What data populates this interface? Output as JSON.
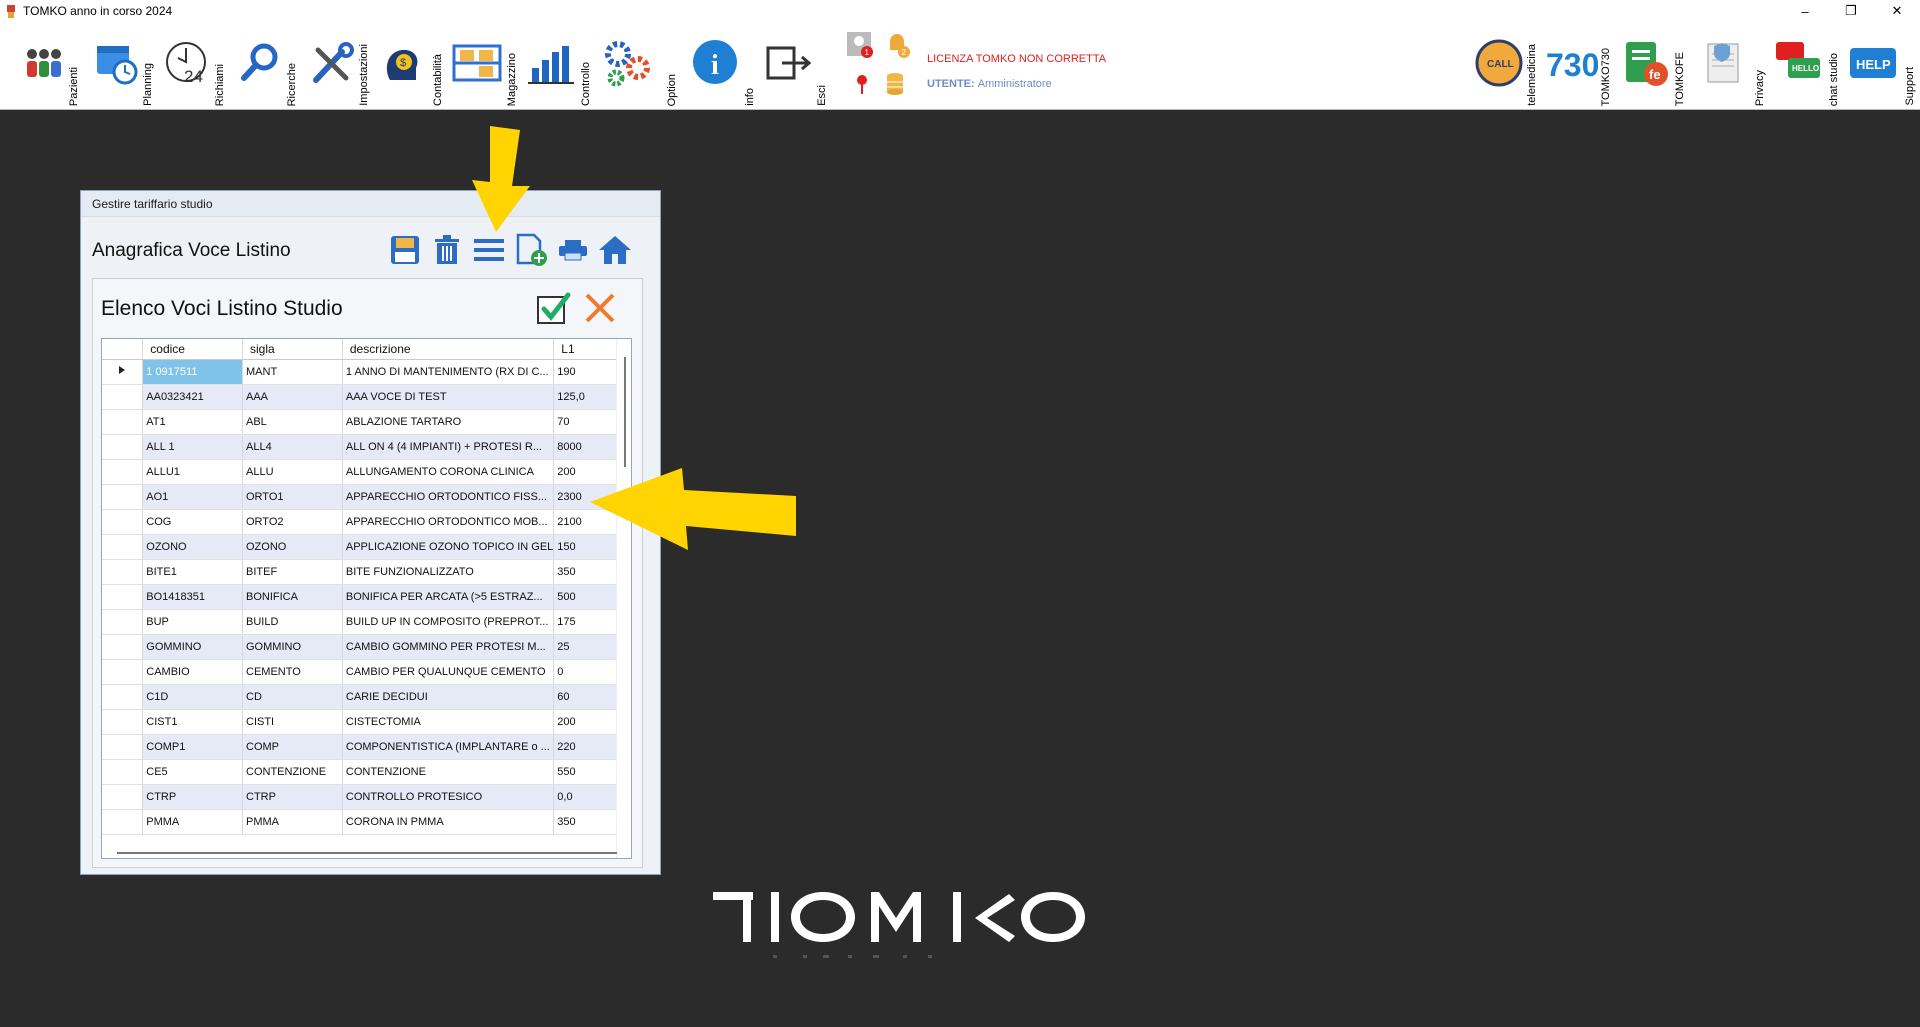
{
  "window": {
    "title": "TOMKO anno in corso 2024",
    "controls": [
      "–",
      "❐",
      "✕"
    ]
  },
  "toolbar": {
    "items": [
      {
        "label": "Pazienti",
        "icon": "patients-icon"
      },
      {
        "label": "Planning",
        "icon": "calendar-icon"
      },
      {
        "label": "Richiami",
        "icon": "clock-24-icon"
      },
      {
        "label": "Ricerche",
        "icon": "search-icon"
      },
      {
        "label": "Impostazioni",
        "icon": "tools-icon"
      },
      {
        "label": "Contabilità",
        "icon": "accounting-icon"
      },
      {
        "label": "Magazzino",
        "icon": "warehouse-icon"
      },
      {
        "label": "Controllo",
        "icon": "chart-icon"
      },
      {
        "label": "Option",
        "icon": "gears-icon"
      },
      {
        "label": "info",
        "icon": "info-icon"
      },
      {
        "label": "Esci",
        "icon": "exit-icon"
      }
    ],
    "license_warning": "LICENZA TOMKO NON CORRETTA",
    "user_label": "UTENTE:",
    "user_name": "Amministratore",
    "notif_badges": [
      "1",
      "2"
    ],
    "right_items": [
      {
        "label": "telemedicina",
        "icon": "call-icon",
        "icon_text": "CALL"
      },
      {
        "label": "TOMKO730",
        "icon": "730-icon",
        "icon_text": "730"
      },
      {
        "label": "TOMKOFE",
        "icon": "fe-icon",
        "icon_text": "fe"
      },
      {
        "label": "Privacy",
        "icon": "privacy-icon"
      },
      {
        "label": "chat studio",
        "icon": "chat-icon",
        "icon_text": "HELLO"
      },
      {
        "label": "Support",
        "icon": "help-icon",
        "icon_text": "HELP"
      }
    ]
  },
  "dialog": {
    "title": "Gestire tariffario studio",
    "header_title": "Anagrafica Voce Listino",
    "inner_title": "Elenco Voci Listino Studio",
    "columns": [
      "codice",
      "sigla",
      "descrizione",
      "L1"
    ],
    "rows": [
      [
        "1 0917511",
        "MANT",
        "1 ANNO DI MANTENIMENTO (RX DI C...",
        "190"
      ],
      [
        "AA0323421",
        "AAA",
        "AAA VOCE DI TEST",
        "125,0"
      ],
      [
        "AT1",
        "ABL",
        "ABLAZIONE TARTARO",
        "70"
      ],
      [
        "ALL 1",
        "ALL4",
        "ALL ON 4 (4 IMPIANTI) + PROTESI R...",
        "8000"
      ],
      [
        "ALLU1",
        "ALLU",
        "ALLUNGAMENTO CORONA CLINICA",
        "200"
      ],
      [
        "AO1",
        "ORTO1",
        "APPARECCHIO ORTODONTICO FISS...",
        "2300"
      ],
      [
        "COG",
        "ORTO2",
        "APPARECCHIO ORTODONTICO MOB...",
        "2100"
      ],
      [
        "OZONO",
        "OZONO",
        "APPLICAZIONE OZONO TOPICO IN GEL",
        "150"
      ],
      [
        "BITE1",
        "BITEF",
        "BITE FUNZIONALIZZATO",
        "350"
      ],
      [
        "BO1418351",
        "BONIFICA",
        "BONIFICA PER ARCATA (>5 ESTRAZ...",
        "500"
      ],
      [
        "BUP",
        "BUILD",
        "BUILD UP IN COMPOSITO (PREPROT...",
        "175"
      ],
      [
        "GOMMINO",
        "GOMMINO",
        "CAMBIO GOMMINO PER PROTESI M...",
        "25"
      ],
      [
        "CAMBIO",
        "CEMENTO",
        "CAMBIO PER QUALUNQUE CEMENTO",
        "0"
      ],
      [
        "C1D",
        "CD",
        "CARIE DECIDUI",
        "60"
      ],
      [
        "CIST1",
        "CISTI",
        "CISTECTOMIA",
        "200"
      ],
      [
        "COMP1",
        "COMP",
        "COMPONENTISTICA (IMPLANTARE o ...",
        "220"
      ],
      [
        "CE5",
        "CONTENZIONE",
        "CONTENZIONE",
        "550"
      ],
      [
        "CTRP",
        "CTRP",
        "CONTROLLO PROTESICO",
        "0,0"
      ],
      [
        "PMMA",
        "PMMA",
        "CORONA IN PMMA",
        "350"
      ]
    ]
  },
  "colors": {
    "background": "#2b2b2b",
    "selected_cell": "#7fc4e8",
    "arrow": "#ffd400",
    "license": "#e0201e"
  }
}
